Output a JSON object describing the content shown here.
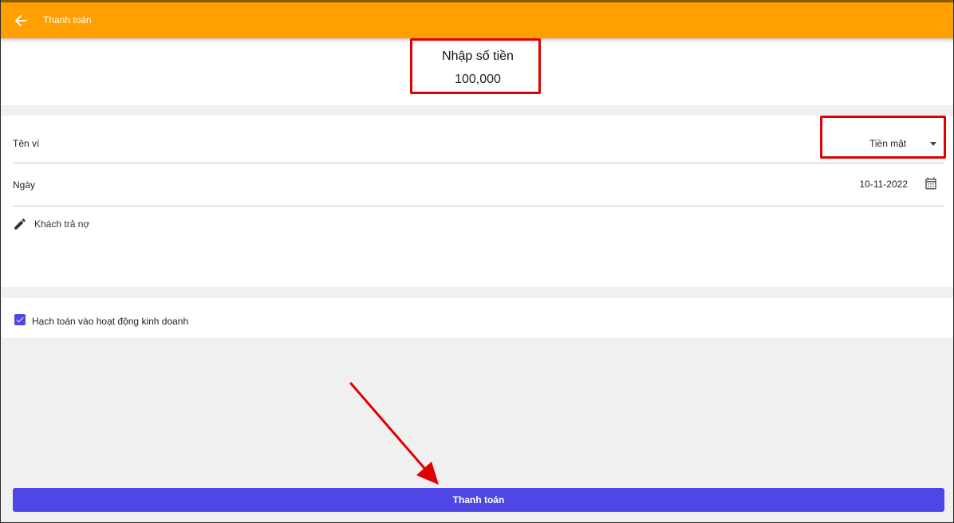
{
  "appbar": {
    "title": "Thanh toán",
    "back_icon": "arrow-left-icon",
    "color": "#ffa000"
  },
  "amount": {
    "label": "Nhập số tiền",
    "value": "100,000"
  },
  "form": {
    "wallet": {
      "label": "Tên ví",
      "selected": "Tiền mặt"
    },
    "date": {
      "label": "Ngày",
      "value": "10-11-2022",
      "icon": "calendar-icon"
    },
    "note": {
      "icon": "pencil-icon",
      "text": "Khách trả nợ"
    }
  },
  "accounting": {
    "label": "Hạch toán vào hoạt động kinh doanh",
    "checked": true
  },
  "submit": {
    "label": "Thanh toán",
    "color": "#5046e5"
  },
  "annotations": {
    "highlight_color": "#e00000"
  }
}
